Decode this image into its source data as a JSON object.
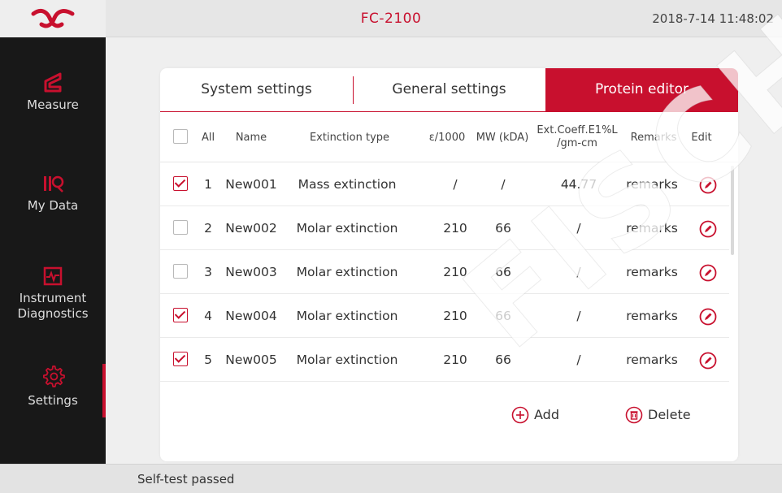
{
  "header": {
    "device_title": "FC-2100",
    "datetime": "2018-7-14 11:48:02",
    "logo_icon": "brand-logo-icon"
  },
  "sidebar": {
    "items": [
      {
        "label": "Measure",
        "icon": "measure-icon",
        "active": false
      },
      {
        "label": "My Data",
        "icon": "my-data-icon",
        "active": false
      },
      {
        "label": "Instrument Diagnostics",
        "icon": "diagnostics-icon",
        "active": false
      },
      {
        "label": "Settings",
        "icon": "gear-icon",
        "active": true
      }
    ]
  },
  "tabs": [
    {
      "label": "System settings",
      "active": false
    },
    {
      "label": "General settings",
      "active": false
    },
    {
      "label": "Protein editor",
      "active": true
    }
  ],
  "table": {
    "headers": {
      "all": "All",
      "name": "Name",
      "extinction_type": "Extinction type",
      "epsilon": "ε/1000",
      "mw": "MW (kDA)",
      "coeff_line1": "Ext.Coeff.E1%L",
      "coeff_line2": "/gm-cm",
      "remarks": "Remarks",
      "edit": "Edit"
    },
    "rows": [
      {
        "num": "1",
        "name": "New001",
        "extinction_type": "Mass extinction",
        "epsilon": "/",
        "mw": "/",
        "coeff": "44.77",
        "remarks": "remarks",
        "checked": true
      },
      {
        "num": "2",
        "name": "New002",
        "extinction_type": "Molar extinction",
        "epsilon": "210",
        "mw": "66",
        "coeff": "/",
        "remarks": "remarks",
        "checked": false
      },
      {
        "num": "3",
        "name": "New003",
        "extinction_type": "Molar extinction",
        "epsilon": "210",
        "mw": "66",
        "coeff": "/",
        "remarks": "remarks",
        "checked": false
      },
      {
        "num": "4",
        "name": "New004",
        "extinction_type": "Molar extinction",
        "epsilon": "210",
        "mw": "66",
        "coeff": "/",
        "remarks": "remarks",
        "checked": true
      },
      {
        "num": "5",
        "name": "New005",
        "extinction_type": "Molar extinction",
        "epsilon": "210",
        "mw": "66",
        "coeff": "/",
        "remarks": "remarks",
        "checked": true
      }
    ]
  },
  "actions": {
    "add_label": "Add",
    "delete_label": "Delete"
  },
  "status": {
    "text": "Self-test passed"
  },
  "watermark": "FISCHER",
  "colors": {
    "accent": "#c8102e",
    "sidebar_bg": "#181818",
    "page_bg": "#efefef"
  }
}
